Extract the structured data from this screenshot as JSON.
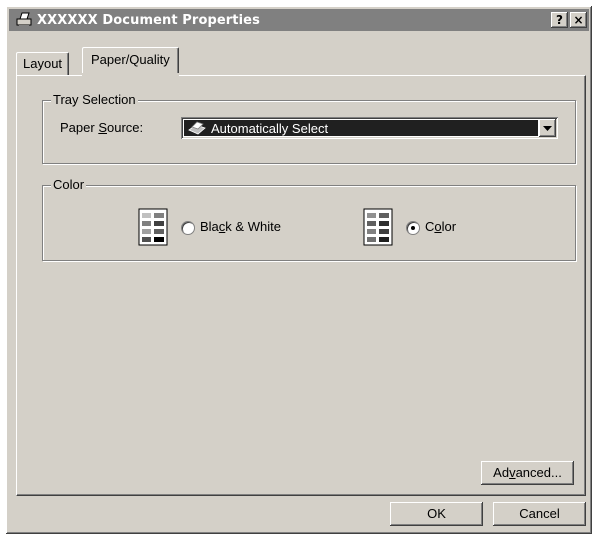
{
  "window": {
    "title": "XXXXXX Document Properties",
    "help_button": "?",
    "close_button": "×"
  },
  "tabs": [
    {
      "label": "Layout",
      "active": false
    },
    {
      "label": "Paper/Quality",
      "active": true
    }
  ],
  "tray_selection": {
    "group_label": "Tray Selection",
    "paper_source_label": "Paper Source:",
    "paper_source_value": "Automatically Select"
  },
  "color": {
    "group_label": "Color",
    "bw_label": "Black & White",
    "color_label": "Color",
    "selected": "Color"
  },
  "buttons": {
    "advanced": "Advanced...",
    "ok": "OK",
    "cancel": "Cancel"
  }
}
